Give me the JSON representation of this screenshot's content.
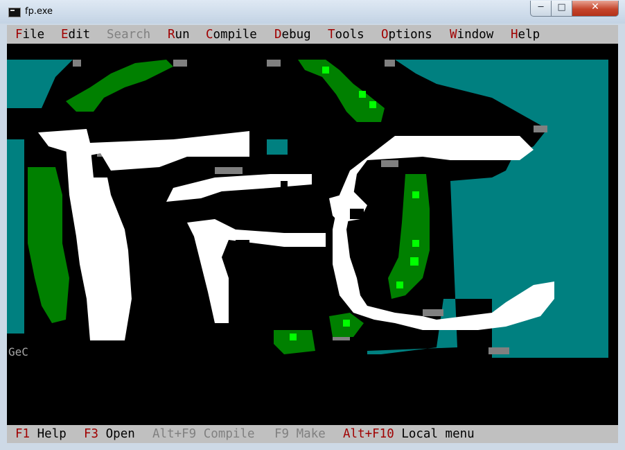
{
  "window": {
    "title": "fp.exe",
    "min_glyph": "─",
    "max_glyph": "□",
    "close_glyph": "✕"
  },
  "menu": [
    {
      "hk": "F",
      "rest": "ile",
      "disabled": false
    },
    {
      "hk": "E",
      "rest": "dit",
      "disabled": false
    },
    {
      "hk": "",
      "rest": "Search",
      "disabled": true
    },
    {
      "hk": "R",
      "rest": "un",
      "disabled": false
    },
    {
      "hk": "C",
      "rest": "ompile",
      "disabled": false
    },
    {
      "hk": "D",
      "rest": "ebug",
      "disabled": false
    },
    {
      "hk": "T",
      "rest": "ools",
      "disabled": false
    },
    {
      "hk": "O",
      "rest": "ptions",
      "disabled": false
    },
    {
      "hk": "W",
      "rest": "indow",
      "disabled": false
    },
    {
      "hk": "H",
      "rest": "elp",
      "disabled": false
    }
  ],
  "desktop_label": "GeC",
  "status": [
    {
      "key": "F1",
      "label": "Help",
      "disabled": false
    },
    {
      "key": "F3",
      "label": "Open",
      "disabled": false
    },
    {
      "key": "Alt+F9",
      "label": "Compile",
      "disabled": true
    },
    {
      "key": "F9",
      "label": "Make",
      "disabled": true
    },
    {
      "key": "Alt+F10",
      "label": "Local menu",
      "disabled": false
    }
  ],
  "colors": {
    "teal": "#008080",
    "green": "#008000",
    "bright_green": "#00ff00",
    "white": "#ffffff",
    "gray": "#808080",
    "light_gray": "#c0c0c0",
    "hotkey_red": "#a00000"
  }
}
